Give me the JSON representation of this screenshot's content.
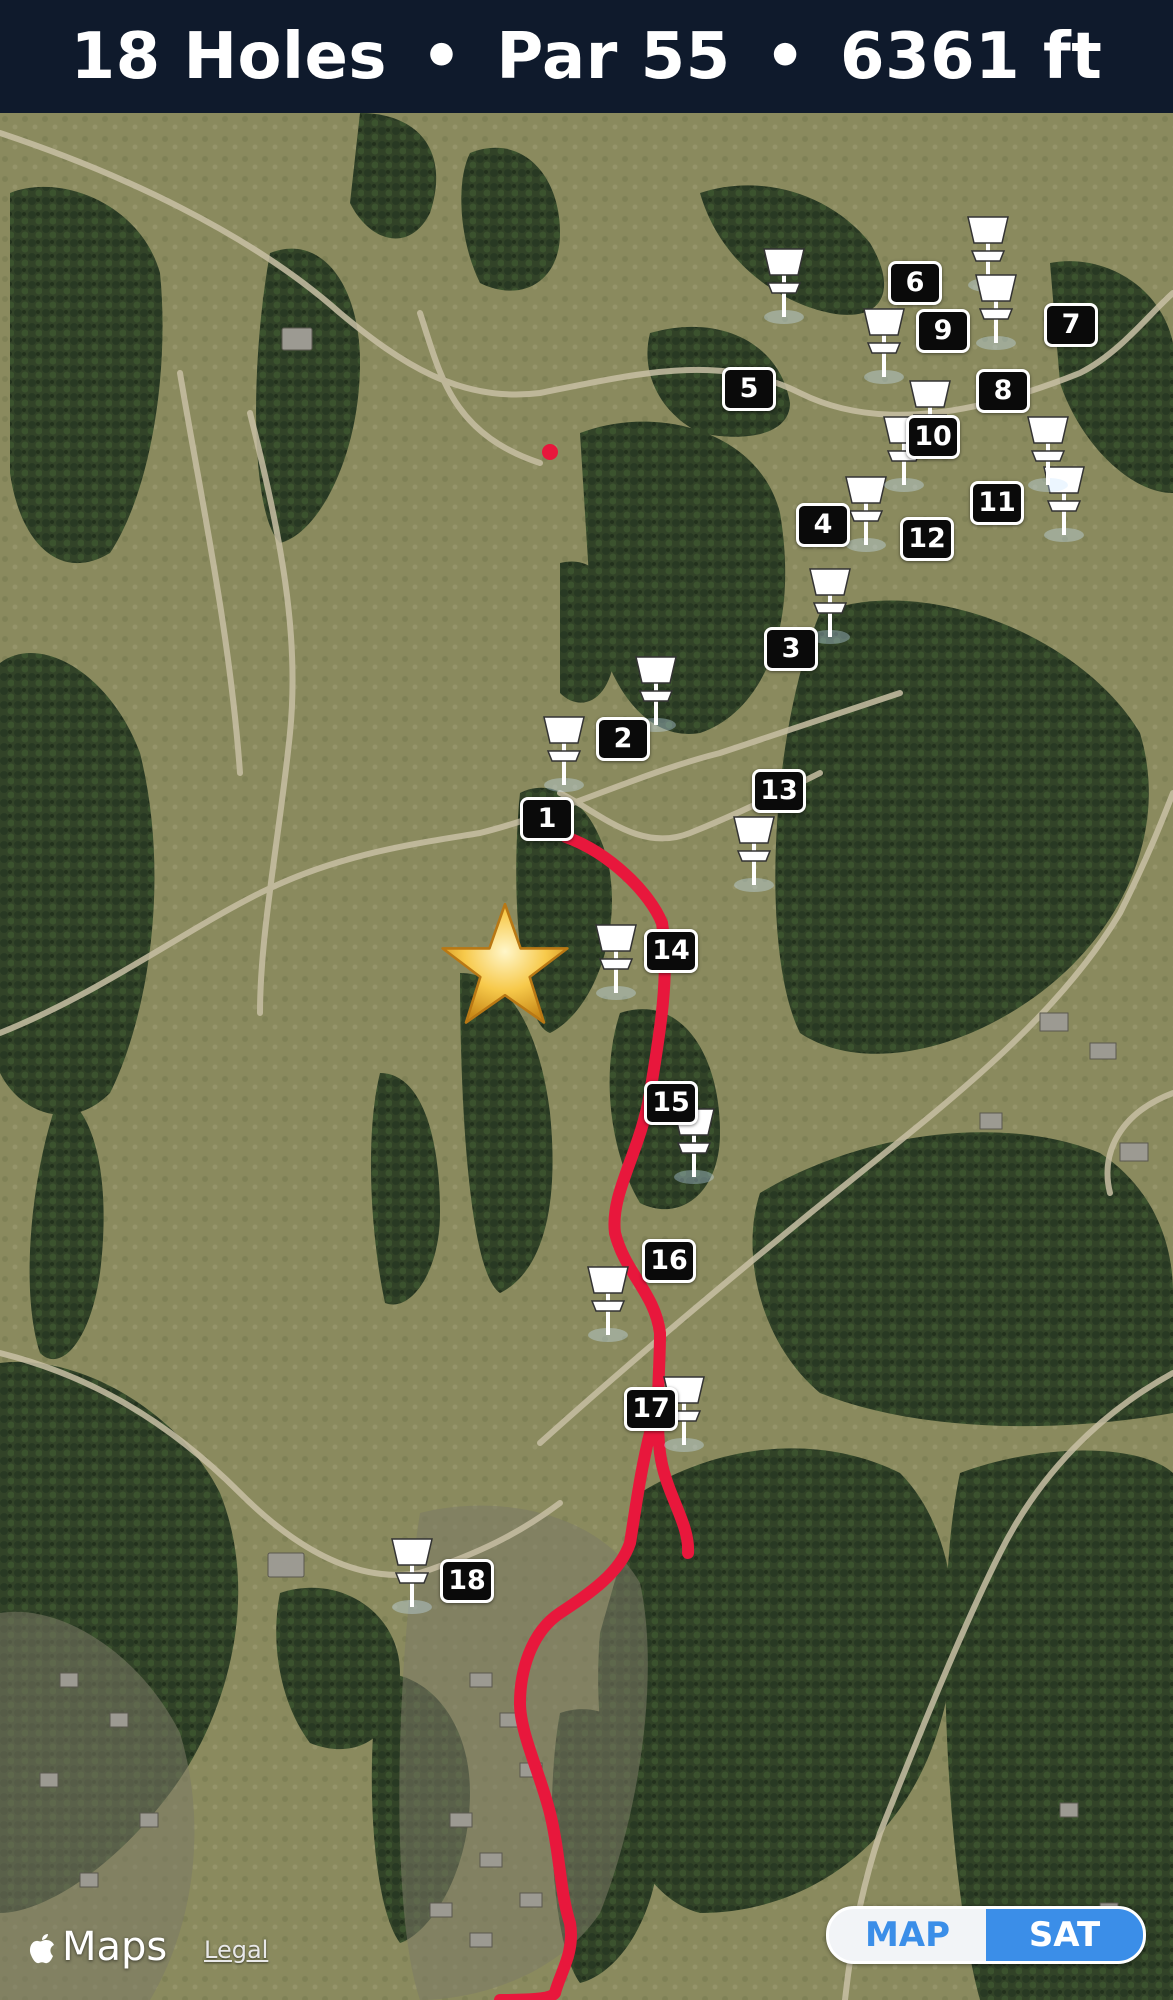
{
  "header": {
    "holes": "18 Holes",
    "separator": "•",
    "par": "Par 55",
    "distance": "6361 ft"
  },
  "map": {
    "route_color": "#e8173c",
    "start_marker": "star-icon",
    "basket_icon": "disc-golf-basket-icon",
    "holes": [
      "1",
      "2",
      "3",
      "4",
      "5",
      "6",
      "7",
      "8",
      "9",
      "10",
      "11",
      "12",
      "13",
      "14",
      "15",
      "16",
      "17",
      "18"
    ]
  },
  "attribution": {
    "brand": "Maps",
    "legal": "Legal"
  },
  "map_type_toggle": {
    "map_label": "MAP",
    "sat_label": "SAT",
    "selected": "SAT",
    "accent_color": "#3b8ee8"
  }
}
